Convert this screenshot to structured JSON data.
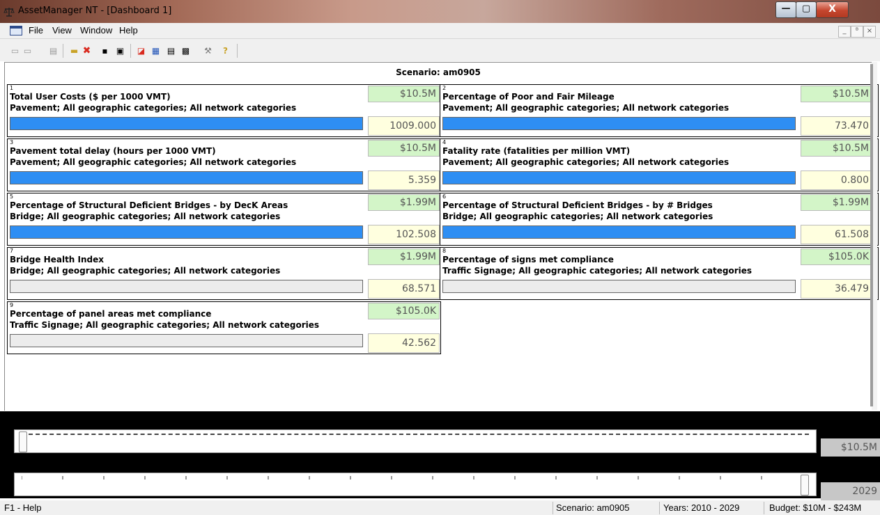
{
  "window": {
    "title": "AssetManager NT - [Dashboard 1]",
    "min_glyph": "—",
    "max_glyph": "▢",
    "close_glyph": "X"
  },
  "menu": {
    "items": [
      "File",
      "View",
      "Window",
      "Help"
    ],
    "mdi_buttons": [
      "_",
      "ᴮ",
      "×"
    ]
  },
  "toolbar": {
    "icons": [
      "import-icon",
      "export-icon",
      "chart-icon",
      "open-folder-icon",
      "delete-icon",
      "save-icon",
      "print-icon",
      "report-icon",
      "map-icon",
      "table-icon",
      "grid-icon",
      "tools-icon",
      "help-icon"
    ],
    "glyphs": [
      "▭",
      "▭",
      "▤",
      "▬",
      "✖",
      "▪",
      "▣",
      "◪",
      "▦",
      "▤",
      "▩",
      "⚒",
      "?"
    ],
    "colors": {
      "red": "#d92b20",
      "blue": "#2154b8",
      "gold": "#c9a227"
    }
  },
  "dashboard": {
    "scenario_label": "Scenario: am0905",
    "panels": [
      {
        "num": "1",
        "title": "Total User Costs ($ per 1000 VMT)",
        "subtitle": "Pavement; All geographic categories; All network categories",
        "budget": "$10.5M",
        "value": "1009.000",
        "bar": "blue"
      },
      {
        "num": "2",
        "title": "Percentage of Poor and Fair Mileage",
        "subtitle": "Pavement; All geographic categories; All network categories",
        "budget": "$10.5M",
        "value": "73.470",
        "bar": "blue"
      },
      {
        "num": "3",
        "title": "Pavement total delay (hours per 1000 VMT)",
        "subtitle": "Pavement; All geographic categories; All network categories",
        "budget": "$10.5M",
        "value": "5.359",
        "bar": "blue"
      },
      {
        "num": "4",
        "title": "Fatality rate (fatalities per million VMT)",
        "subtitle": "Pavement; All geographic categories; All network categories",
        "budget": "$10.5M",
        "value": "0.800",
        "bar": "blue"
      },
      {
        "num": "5",
        "title": "Percentage of Structural Deficient Bridges - by DecK Areas",
        "subtitle": "Bridge; All geographic categories; All network categories",
        "budget": "$1.99M",
        "value": "102.508",
        "bar": "blue"
      },
      {
        "num": "6",
        "title": "Percentage of Structural Deficient Bridges - by # Bridges",
        "subtitle": "Bridge; All geographic categories; All network categories",
        "budget": "$1.99M",
        "value": "61.508",
        "bar": "blue"
      },
      {
        "num": "7",
        "title": "Bridge Health Index",
        "subtitle": "Bridge; All geographic categories; All network categories",
        "budget": "$1.99M",
        "value": "68.571",
        "bar": "grey"
      },
      {
        "num": "8",
        "title": "Percentage of signs met compliance",
        "subtitle": "Traffic Signage; All geographic categories; All network categories",
        "budget": "$105.0K",
        "value": "36.479",
        "bar": "grey"
      },
      {
        "num": "9",
        "title": "Percentage of panel areas met compliance",
        "subtitle": "Traffic Signage; All geographic categories; All network categories",
        "budget": "$105.0K",
        "value": "42.562",
        "bar": "grey"
      }
    ]
  },
  "sliders": {
    "budget_value": "$10.5M",
    "year_value": "2029"
  },
  "status": {
    "help": "F1 - Help",
    "scenario": "Scenario: am0905",
    "years": "Years: 2010 - 2029",
    "budget": "Budget: $10M - $243M"
  }
}
